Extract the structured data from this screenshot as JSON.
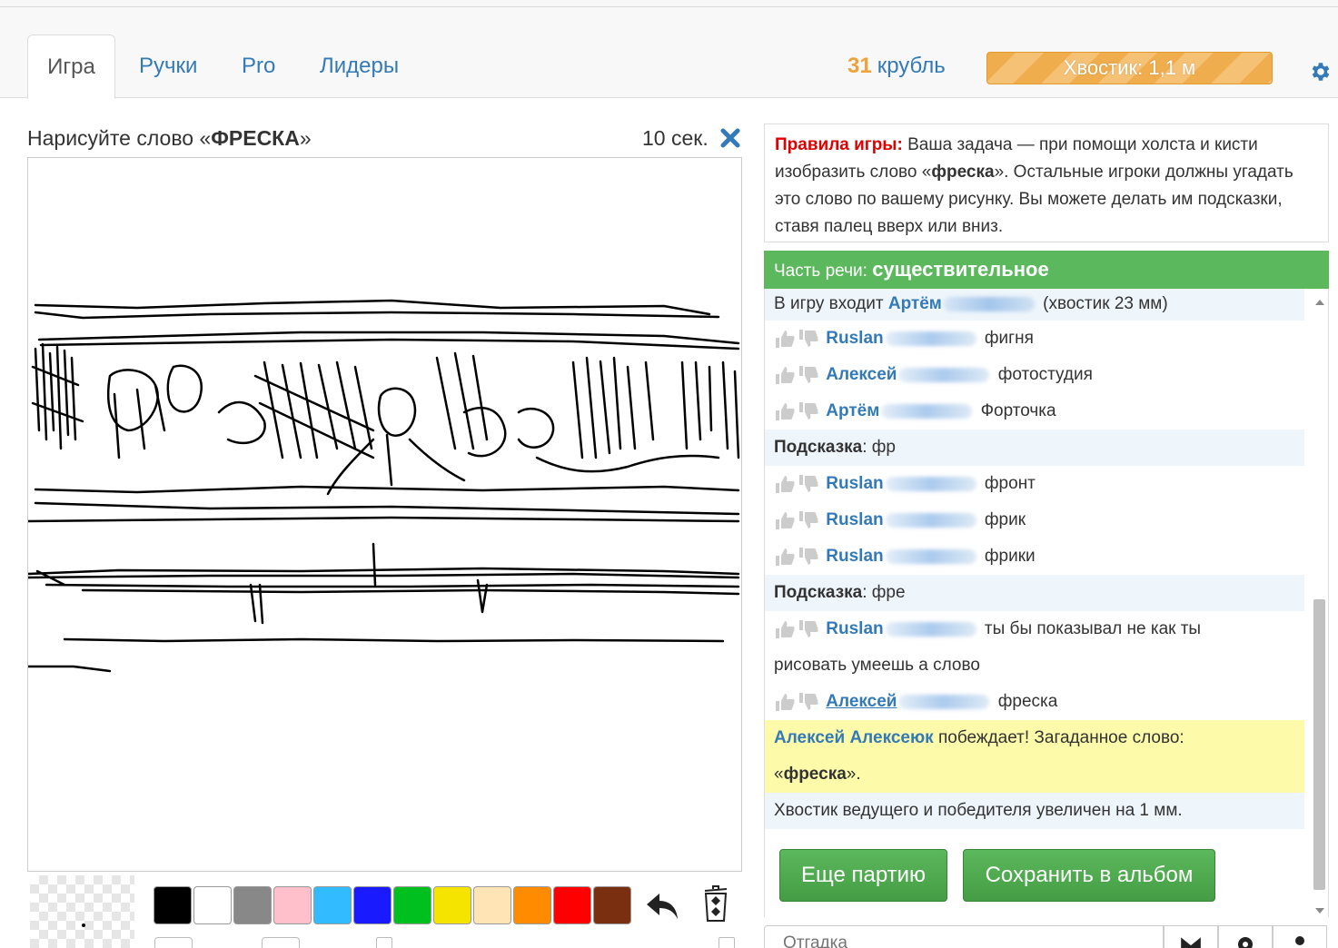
{
  "nav": {
    "tabs": [
      {
        "label": "Игра",
        "active": true
      },
      {
        "label": "Ручки"
      },
      {
        "label": "Pro"
      },
      {
        "label": "Лидеры"
      }
    ],
    "coins_value": "31",
    "coins_label": "крубль",
    "tail_label": "Хвостик: 1,1 м",
    "settings_icon": "gear-icon"
  },
  "game": {
    "task_prefix": "Нарисуйте слово «",
    "task_word": "ФРЕСКА",
    "task_suffix": "»",
    "timer": "10 сек.",
    "close_icon": "close-icon"
  },
  "palette": {
    "colors": [
      "#000000",
      "#ffffff",
      "#888888",
      "#ffc0cb",
      "#33bbff",
      "#1a1aff",
      "#00c020",
      "#f5e400",
      "#ffe4b5",
      "#ff8c00",
      "#ff0000",
      "#7a3010"
    ],
    "undo_icon": "undo-icon",
    "clear_icon": "clear-canvas-icon"
  },
  "rules": {
    "title": "Правила игры:",
    "text_1": " Ваша задача — при помощи холста и кисти изобразить слово «",
    "word": "фреска",
    "text_2": "». Остальные игроки должны угадать это слово по вашему рисунку. Вы можете делать им подсказки, ставя палец вверх или вниз."
  },
  "part_of_speech": {
    "label": "Часть речи:",
    "value": "существительное"
  },
  "chat": {
    "join": {
      "prefix": "В игру входит",
      "user": "Артём",
      "suffix": "(хвостик 23 мм)"
    },
    "guesses1": [
      {
        "user": "Ruslan",
        "text": "фигня"
      },
      {
        "user": "Алексей",
        "text": "фотостудия"
      },
      {
        "user": "Артём",
        "text": "Форточка"
      }
    ],
    "hint1": {
      "label": "Подсказка",
      "value": ": фр"
    },
    "guesses2": [
      {
        "user": "Ruslan",
        "text": "фронт"
      },
      {
        "user": "Ruslan",
        "text": "фрик"
      },
      {
        "user": "Ruslan",
        "text": "фрики"
      }
    ],
    "hint2": {
      "label": "Подсказка",
      "value": ": фре"
    },
    "comment": {
      "user": "Ruslan",
      "text": "ты бы показывал не как ты",
      "text_cont": "рисовать умеешь а слово"
    },
    "final_guess": {
      "user": "Алексей",
      "text": "фреска"
    },
    "win": {
      "user": "Алексей Алексеюк",
      "text": "побеждает! Загаданное слово:",
      "word_open": "«",
      "word": "фреска",
      "word_close": "»."
    },
    "tail_msg": "Хвостик ведущего и победителя увеличен на 1 мм."
  },
  "buttons": {
    "again": "Еще партию",
    "save": "Сохранить в альбом"
  },
  "bottom": {
    "placeholder": "Отгадка",
    "icons": [
      "envelope-icon",
      "gear-icon",
      "user-icon"
    ]
  }
}
